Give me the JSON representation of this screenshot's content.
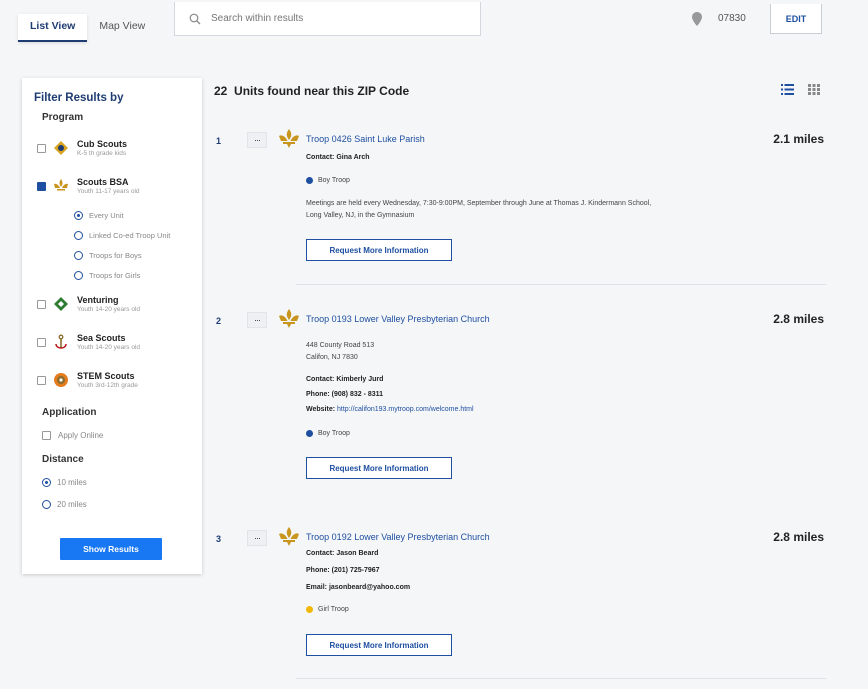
{
  "tabs": {
    "list": "List View",
    "map": "Map View"
  },
  "search": {
    "placeholder": "Search within results"
  },
  "location": {
    "zip": "07830",
    "edit_label": "EDIT"
  },
  "filter": {
    "title": "Filter Results by",
    "program_title": "Program",
    "programs": [
      {
        "name": "Cub Scouts",
        "sub": "K-5 th grade kids",
        "checked": false
      },
      {
        "name": "Scouts BSA",
        "sub": "Youth 11-17 years old",
        "checked": true
      },
      {
        "name": "Venturing",
        "sub": "Youth 14-20 years old",
        "checked": false
      },
      {
        "name": "Sea Scouts",
        "sub": "Youth 14-20 years old",
        "checked": false
      },
      {
        "name": "STEM Scouts",
        "sub": "Youth 3rd-12th grade",
        "checked": false
      }
    ],
    "sub_options": [
      {
        "label": "Every Unit",
        "checked": true
      },
      {
        "label": "Linked Co-ed Troop Unit",
        "checked": false
      },
      {
        "label": "Troops for Boys",
        "checked": false
      },
      {
        "label": "Troops for Girls",
        "checked": false
      }
    ],
    "application_title": "Application",
    "apply_online": "Apply Online",
    "distance_title": "Distance",
    "distance_options": [
      {
        "label": "10 miles",
        "checked": true
      },
      {
        "label": "20 miles",
        "checked": false
      }
    ],
    "show_results": "Show Results"
  },
  "results": {
    "count": "22",
    "heading": "Units found near this ZIP Code",
    "units": [
      {
        "num": "1",
        "name": "Troop 0426 Saint Luke Parish",
        "distance": "2.1 miles",
        "contact": "Contact: Gina Arch",
        "type": "Boy Troop",
        "type_color": "#1e4fa0",
        "note": "Meetings are held every Wednesday, 7:30-9:00PM, September through June at Thomas J. Kindermann School,",
        "note2": "Long Valley, NJ, in the Gymnasium",
        "request": "Request More Information"
      },
      {
        "num": "2",
        "name": "Troop 0193 Lower Valley Presbyterian Church",
        "distance": "2.8 miles",
        "address1": "448 County Road 513",
        "address2": "Califon, NJ 7830",
        "contact": "Contact: Kimberly Jurd",
        "phone": "Phone: (908) 832 - 8311",
        "website_label": "Website:",
        "website": "http://califon193.mytroop.com/welcome.html",
        "type": "Boy Troop",
        "type_color": "#1e4fa0",
        "request": "Request More Information"
      },
      {
        "num": "3",
        "name": "Troop 0192 Lower Valley Presbyterian Church",
        "distance": "2.8 miles",
        "contact": "Contact: Jason Beard",
        "phone": "Phone: (201) 725-7967",
        "email": "Email: jasonbeard@yahoo.com",
        "type": "Girl Troop",
        "type_color": "#f2b705",
        "request": "Request More Information"
      }
    ]
  }
}
